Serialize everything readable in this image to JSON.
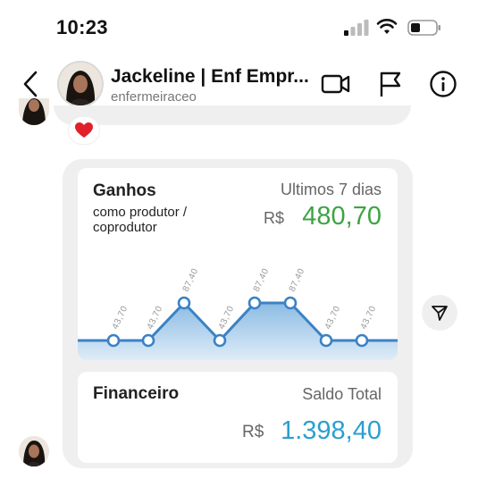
{
  "status_bar": {
    "time": "10:23"
  },
  "header": {
    "name": "Jackeline | Enf Empr...",
    "username": "enfermeiraceo"
  },
  "message": {
    "reaction": "heart-emoji",
    "ganhos": {
      "title": "Ganhos",
      "subtitle": "como produtor / coprodutor",
      "period": "Ultimos 7 dias",
      "currency": "R$",
      "amount": "480,70"
    },
    "financeiro": {
      "title": "Financeiro",
      "label": "Saldo Total",
      "currency": "R$",
      "amount": "1.398,40"
    }
  },
  "chart_data": {
    "type": "area",
    "point_labels": [
      "43,70",
      "43,70",
      "87,40",
      "43,70",
      "87,40",
      "87,40",
      "43,70",
      "43,70"
    ],
    "values": [
      43.7,
      43.7,
      87.4,
      43.7,
      87.4,
      87.4,
      43.7,
      43.7
    ],
    "line_color": "#3b82c4",
    "fill_color": "#b8d6ef"
  },
  "colors": {
    "ganhos_amount": "#3da344",
    "saldo_amount": "#2b9fcf",
    "bubble_bg": "#efefef"
  },
  "icons": [
    "back-icon",
    "video-call-icon",
    "flag-icon",
    "info-icon",
    "share-icon",
    "signal-icon",
    "wifi-icon",
    "battery-icon"
  ]
}
